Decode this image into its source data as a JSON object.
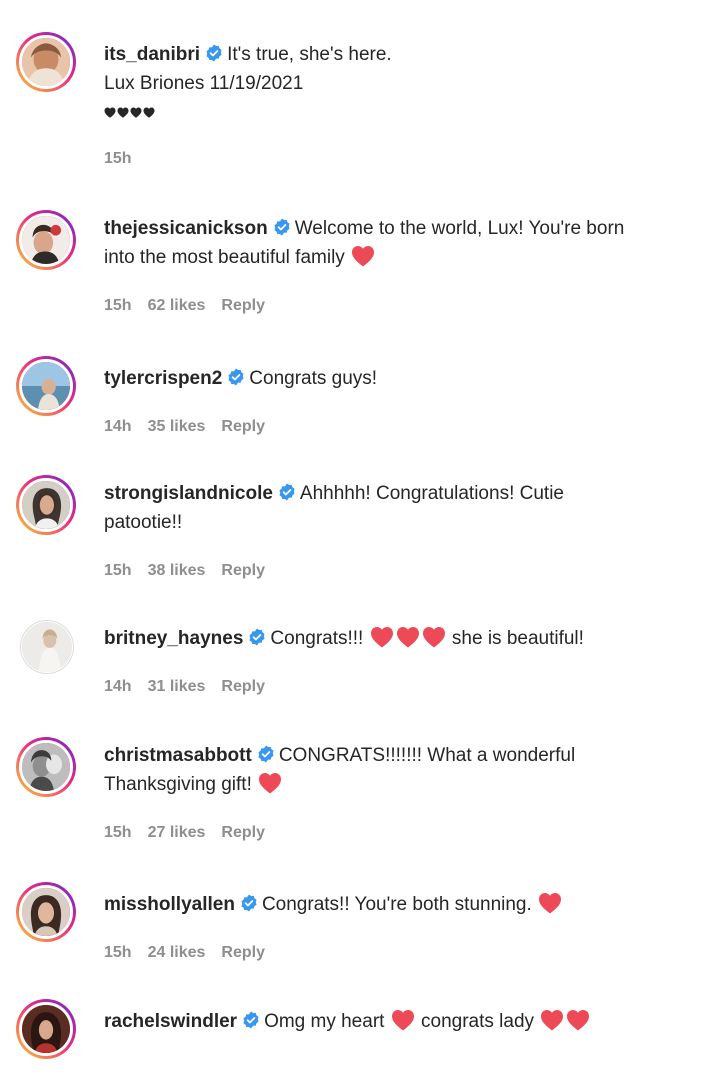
{
  "colors": {
    "text": "#262626",
    "meta": "#8e8e8e",
    "verified": "#3897f0",
    "heart": "#ed4956"
  },
  "comments": [
    {
      "username": "its_danibri",
      "verified": true,
      "line1": "It's true, she's here.",
      "line2": "Lux Briones 11/19/2021",
      "black_hearts": 4,
      "time": "15h"
    },
    {
      "username": "thejessicanickson",
      "verified": true,
      "line1": "Welcome to the world, Lux! You're born",
      "line2": "into the most beautiful family",
      "time": "15h",
      "likes": "62 likes",
      "reply": "Reply"
    },
    {
      "username": "tylercrispen2",
      "verified": true,
      "line1": "Congrats guys!",
      "time": "14h",
      "likes": "35 likes",
      "reply": "Reply"
    },
    {
      "username": "strongislandnicole",
      "verified": true,
      "line1": "Ahhhhh! Congratulations! Cutie",
      "line2": "patootie!!",
      "time": "15h",
      "likes": "38 likes",
      "reply": "Reply"
    },
    {
      "username": "britney_haynes",
      "verified": true,
      "line1_a": "Congrats!!!",
      "line1_b": "she is beautiful!",
      "time": "14h",
      "likes": "31 likes",
      "reply": "Reply"
    },
    {
      "username": "christmasabbott",
      "verified": true,
      "line1": "CONGRATS!!!!!!! What a wonderful",
      "line2": "Thanksgiving gift!",
      "time": "15h",
      "likes": "27 likes",
      "reply": "Reply"
    },
    {
      "username": "misshollyallen",
      "verified": true,
      "line1": "Congrats!! You're both stunning.",
      "time": "15h",
      "likes": "24 likes",
      "reply": "Reply"
    },
    {
      "username": "rachelswindler",
      "verified": true,
      "line1_a": "Omg my heart",
      "line1_b": "congrats lady"
    }
  ]
}
